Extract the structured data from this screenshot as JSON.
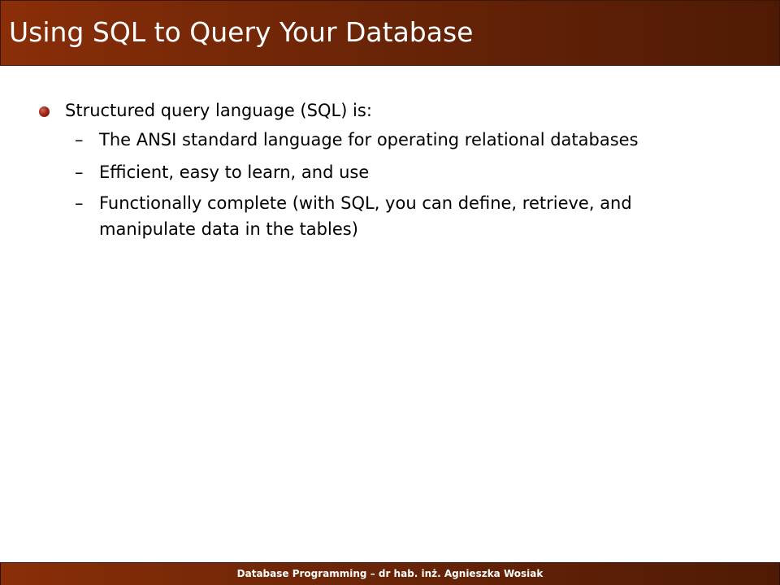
{
  "slide": {
    "title": "Using SQL to Query Your Database",
    "bullet": {
      "text": "Structured query language (SQL) is:",
      "sub_items": [
        {
          "dash": "–",
          "text": "The ANSI standard language for operating relational databases"
        },
        {
          "dash": "–",
          "text": "Efficient, easy to learn, and use"
        },
        {
          "dash": "–",
          "text": "Functionally complete (with SQL, you can define, retrieve, and manipulate data in the tables)"
        }
      ]
    },
    "footer": "Database Programming – dr hab. inż. Agnieszka Wosiak"
  },
  "colors": {
    "bar_light": "#8a2e08",
    "bar_dark": "#4f1a05",
    "bullet": "#a02818",
    "text": "#000000",
    "title_text": "#ffffff"
  },
  "icons": {
    "bullet": "bullet-dot-icon"
  }
}
